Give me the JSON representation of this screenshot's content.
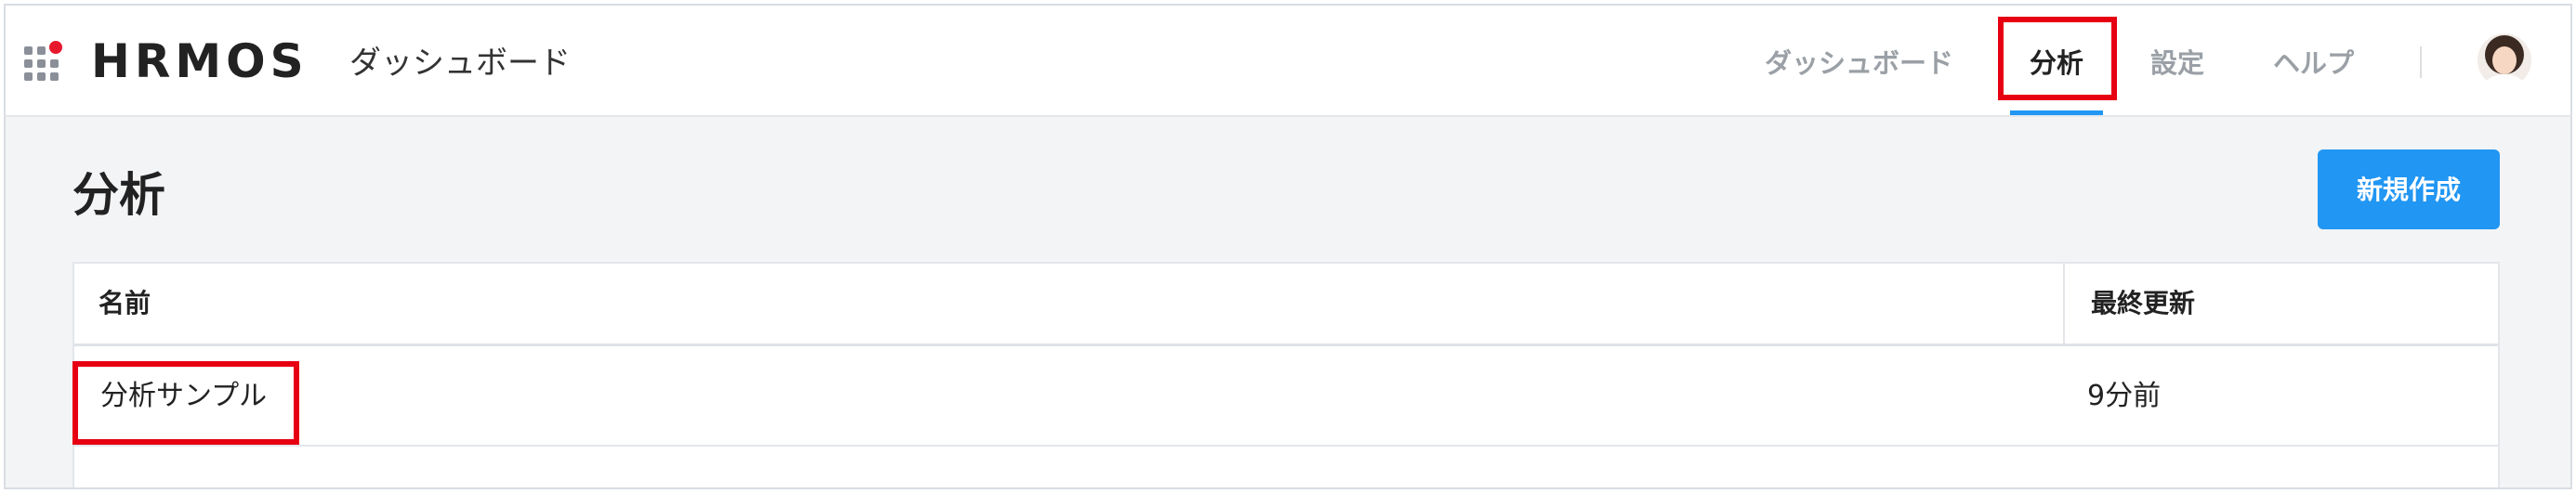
{
  "header": {
    "logo": "HRMOS",
    "app_title": "ダッシュボード",
    "nav": {
      "dashboard": "ダッシュボード",
      "analysis": "分析",
      "settings": "設定",
      "help": "ヘルプ"
    },
    "active_tab": "analysis",
    "accent_color": "#2196f3"
  },
  "page": {
    "title": "分析",
    "new_button": "新規作成"
  },
  "table": {
    "columns": [
      "名前",
      "最終更新"
    ],
    "rows": [
      {
        "name": "分析サンプル",
        "updated": "9分前"
      }
    ]
  },
  "annotations": {
    "highlight_color": "#e60012"
  },
  "icons": {
    "app_launcher": "grid-icon",
    "user": "avatar"
  }
}
